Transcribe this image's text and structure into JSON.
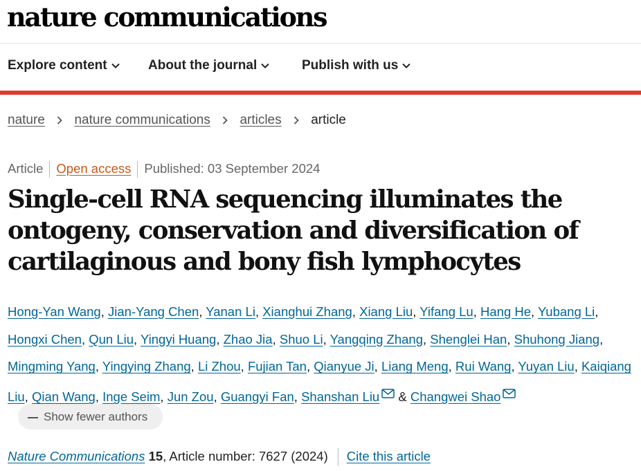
{
  "header": {
    "masthead": "nature communications"
  },
  "nav": {
    "items": [
      {
        "label": "Explore content"
      },
      {
        "label": "About the journal"
      },
      {
        "label": "Publish with us"
      }
    ]
  },
  "colors": {
    "accent_red": "#e0392b",
    "link_blue": "#006699",
    "open_access_orange": "#c4571b"
  },
  "breadcrumb": {
    "items": [
      "nature",
      "nature communications",
      "articles"
    ],
    "current": "article"
  },
  "article": {
    "type": "Article",
    "access": "Open access",
    "published": "Published: 03 September 2024",
    "title": "Single-cell RNA sequencing illuminates the ontogeny, conservation and diversification of cartilaginous and bony fish lymphocytes",
    "authors": [
      "Hong-Yan Wang",
      "Jian-Yang Chen",
      "Yanan Li",
      "Xianghui Zhang",
      "Xiang Liu",
      "Yifang Lu",
      "Hang He",
      "Yubang Li",
      "Hongxi Chen",
      "Qun Liu",
      "Yingyi Huang",
      "Zhao Jia",
      "Shuo Li",
      "Yangqing Zhang",
      "Shenglei Han",
      "Shuhong Jiang",
      "Mingming Yang",
      "Yingying Zhang",
      "Li Zhou",
      "Fujian Tan",
      "Qianyue Ji",
      "Liang Meng",
      "Rui Wang",
      "Yuyan Liu",
      "Kaiqiang Liu",
      "Qian Wang",
      "Inge Seim",
      "Jun Zou",
      "Guangyi Fan",
      "Shanshan Liu",
      "Changwei Shao"
    ],
    "corresponding_icon": "envelope-icon",
    "authors_separator": ",",
    "authors_ampersand": "&",
    "show_fewer_label": "Show fewer authors"
  },
  "citation": {
    "journal": "Nature Communications",
    "volume": "15",
    "article_number": ", Article number: 7627 (2024)",
    "cite_label": "Cite this article"
  }
}
